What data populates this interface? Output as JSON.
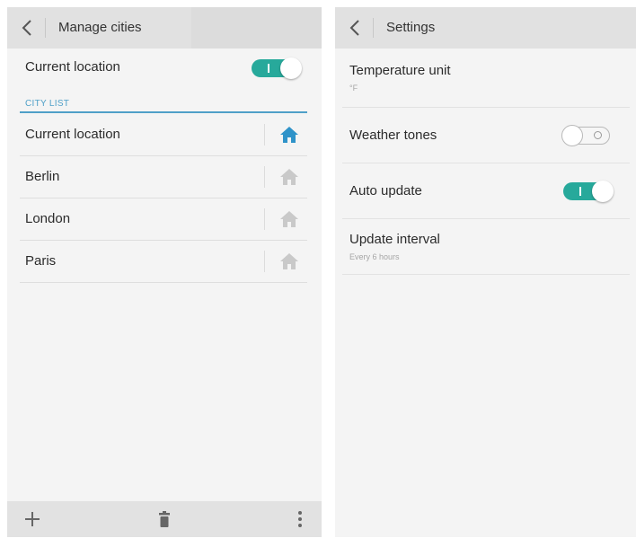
{
  "left_screen": {
    "title": "Manage cities",
    "current_location_label": "Current location",
    "current_location_toggle": "on",
    "section_header": "CITY LIST",
    "cities": [
      {
        "name": "Current location",
        "home_active": true
      },
      {
        "name": "Berlin",
        "home_active": false
      },
      {
        "name": "London",
        "home_active": false
      },
      {
        "name": "Paris",
        "home_active": false
      }
    ],
    "bottom_icons": [
      "add-icon",
      "trash-icon",
      "more-vert-icon"
    ]
  },
  "right_screen": {
    "title": "Settings",
    "items": [
      {
        "label": "Temperature unit",
        "sub": "°F"
      },
      {
        "label": "Weather tones",
        "toggle": "off"
      },
      {
        "label": "Auto update",
        "toggle": "on"
      },
      {
        "label": "Update interval",
        "sub": "Every 6 hours"
      }
    ]
  },
  "colors": {
    "accent": "#27a99b",
    "section": "#4fa0c8",
    "home_active": "#2f93c9",
    "home_inactive": "#c9c9c9"
  }
}
